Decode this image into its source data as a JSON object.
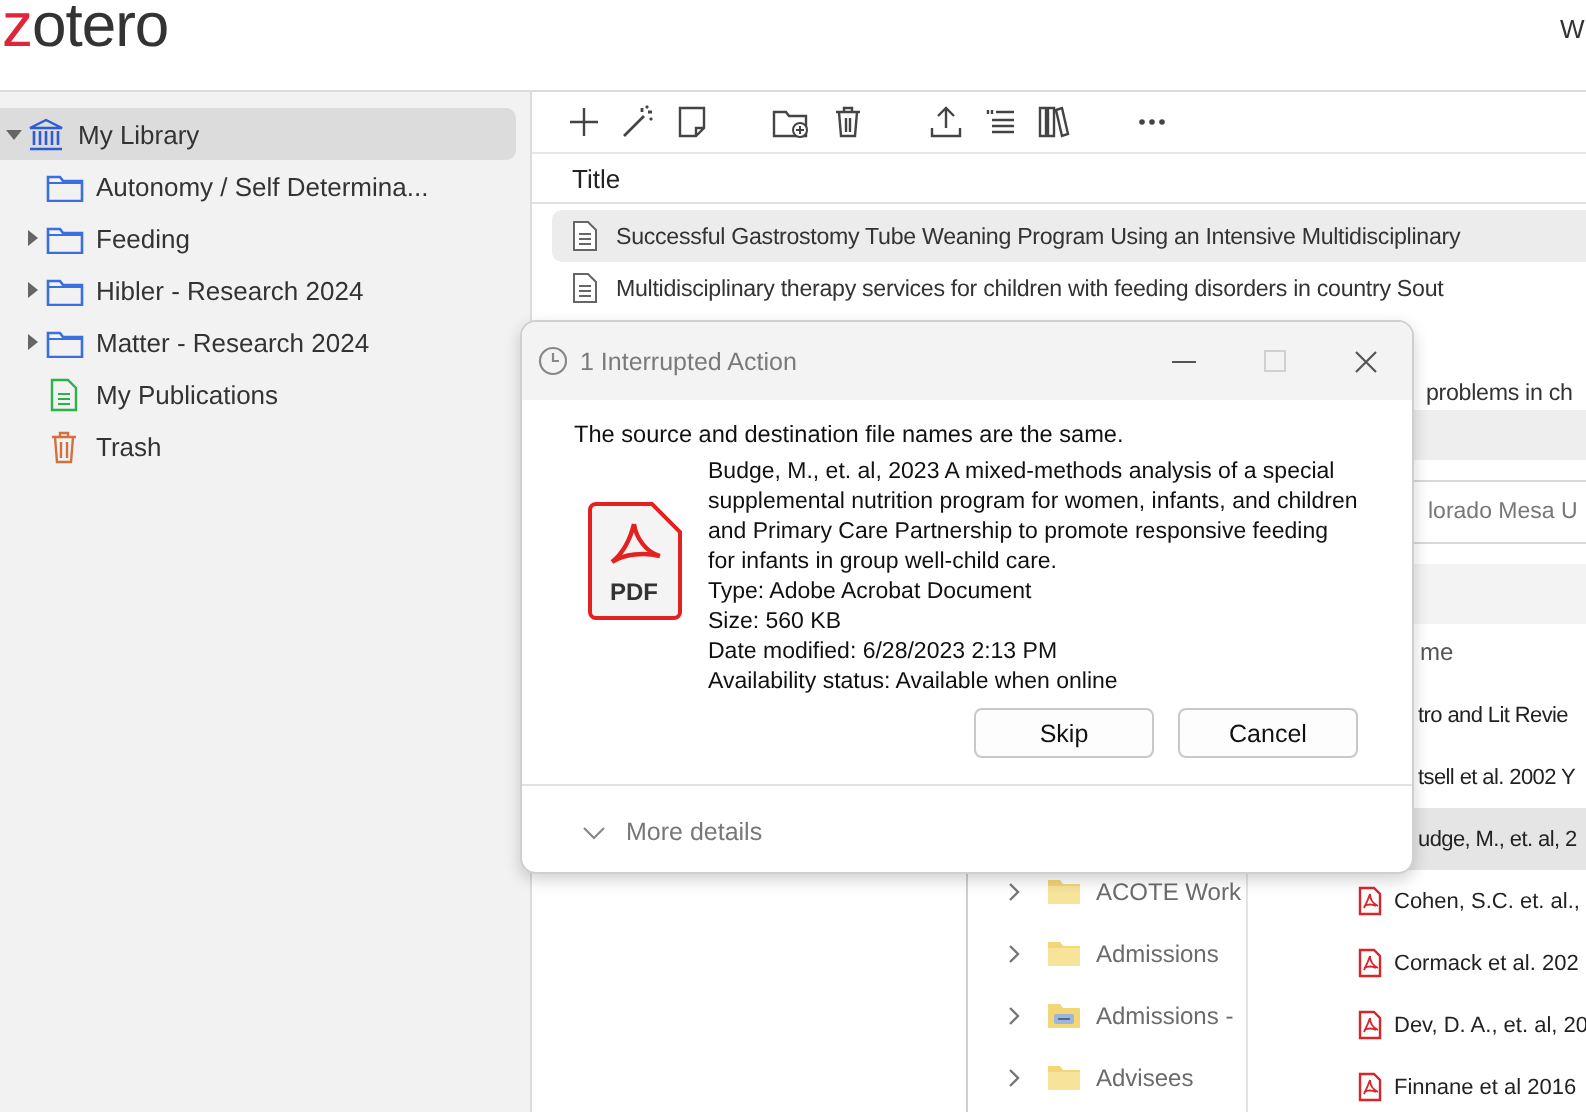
{
  "zotero": {
    "logo": {
      "accent": "z",
      "rest": "otero"
    },
    "header_right": "W",
    "sidebar": {
      "items": [
        {
          "label": "My Library",
          "kind": "library",
          "selected": true,
          "expanded": true,
          "children": [
            {
              "label": "Autonomy / Self Determina...",
              "kind": "folder",
              "selected": false
            },
            {
              "label": "Feeding",
              "kind": "folder",
              "selected": false,
              "expanded": false
            },
            {
              "label": "Hibler - Research 2024",
              "kind": "folder",
              "selected": false,
              "expanded": false
            },
            {
              "label": "Matter - Research 2024",
              "kind": "folder",
              "selected": false,
              "expanded": false
            },
            {
              "label": "My Publications",
              "kind": "publications",
              "selected": false
            },
            {
              "label": "Trash",
              "kind": "trash",
              "selected": false
            }
          ]
        }
      ]
    },
    "items": {
      "column": "Title",
      "rows": [
        {
          "kind": "full",
          "title": "Successful Gastrostomy Tube Weaning Program Using an Intensive Multidisciplinary",
          "selected": true
        },
        {
          "kind": "full",
          "title": "Multidisciplinary therapy services for children with feeding disorders in country Sout",
          "selected": false
        },
        {
          "kind": "covered",
          "selected": false
        },
        {
          "kind": "partial",
          "title": "problems in ch",
          "selected": false
        }
      ]
    }
  },
  "explorer": {
    "address": "lorado Mesa U",
    "column": "me",
    "nav": [
      {
        "label": "ACOTE Work",
        "kind": "folder"
      },
      {
        "label": "Admissions",
        "kind": "folder"
      },
      {
        "label": "Admissions -",
        "kind": "shared-folder"
      },
      {
        "label": "Advisees",
        "kind": "folder"
      }
    ],
    "files": [
      {
        "kind": "partial",
        "name": "tro and Lit Revie",
        "selected": false
      },
      {
        "kind": "partial",
        "name": "tsell et al. 2002 Y",
        "selected": false
      },
      {
        "kind": "partial",
        "name": "udge, M., et. al, 2",
        "selected": true
      },
      {
        "kind": "full",
        "name": "Cohen, S.C. et. al.,",
        "selected": false
      },
      {
        "kind": "full",
        "name": "Cormack et al. 202",
        "selected": false
      },
      {
        "kind": "full",
        "name": "Dev, D. A., et. al, 20",
        "selected": false
      },
      {
        "kind": "full",
        "name": "Finnane et al 2016",
        "selected": false
      }
    ]
  },
  "dialog": {
    "title": "1 Interrupted Action",
    "maximize_disabled": true,
    "message": "The source and destination file names are the same.",
    "file": {
      "icon_label": "PDF",
      "name": "Budge, M., et. al, 2023 A mixed-methods analysis of a special supplemental nutrition program for women, infants, and children and Primary Care Partnership to promote responsive feeding for infants in group well-child care.",
      "type": "Type: Adobe Acrobat Document",
      "size": "Size: 560 KB",
      "modified": "Date modified: 6/28/2023 2:13 PM",
      "availability": "Availability status: Available when online"
    },
    "buttons": [
      {
        "label": "Skip"
      },
      {
        "label": "Cancel"
      }
    ],
    "more_details": "More details"
  }
}
